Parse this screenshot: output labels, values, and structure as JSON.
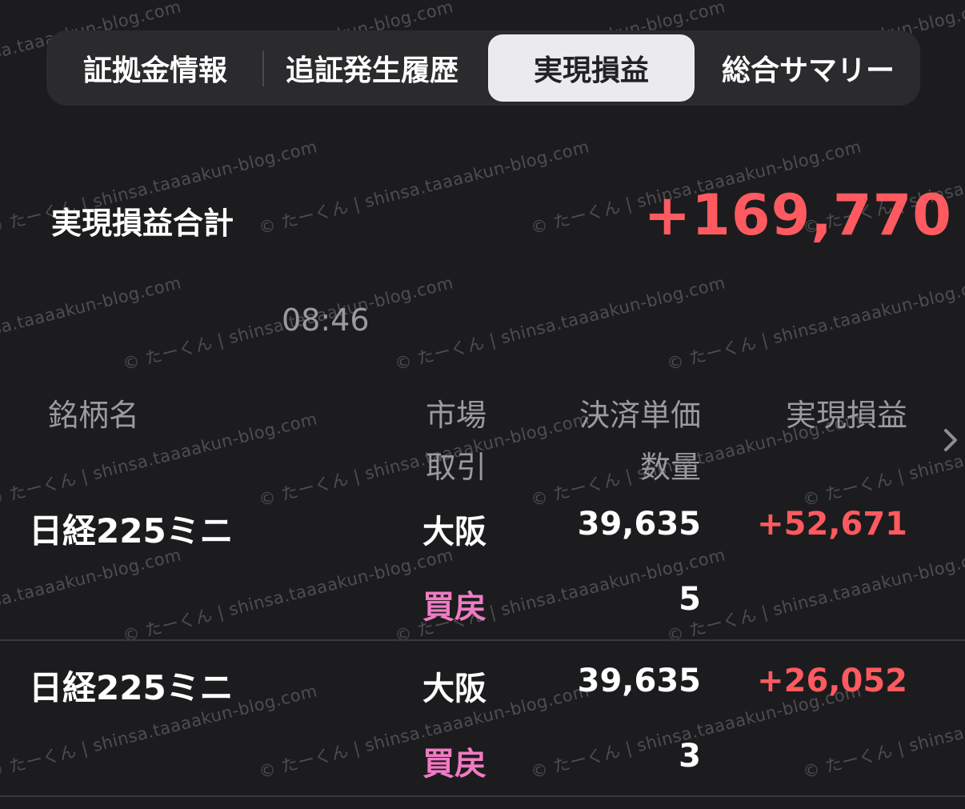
{
  "tabs": [
    {
      "label": "証拠金情報",
      "active": false
    },
    {
      "label": "追証発生履歴",
      "active": false
    },
    {
      "label": "実現損益",
      "active": true
    },
    {
      "label": "総合サマリー",
      "active": false
    }
  ],
  "summary": {
    "label": "実現損益合計",
    "value": "+169,770",
    "time": "08:46"
  },
  "table": {
    "headers": {
      "name": "銘柄名",
      "market": "市場",
      "trade": "取引",
      "price": "決済単価",
      "quantity": "数量",
      "pnl": "実現損益"
    },
    "rows": [
      {
        "name": "日経225ミニ",
        "market": "大阪",
        "price": "39,635",
        "pnl": "+52,671",
        "side": "買戻",
        "quantity": "5"
      },
      {
        "name": "日経225ミニ",
        "market": "大阪",
        "price": "39,635",
        "pnl": "+26,052",
        "side": "買戻",
        "quantity": "3"
      }
    ]
  },
  "watermark": {
    "text": "© たーくん | shinsa.taaaakun-blog.com"
  },
  "colors": {
    "positive": "#ff5a5f",
    "side": "#f07bc3",
    "active_tab_bg": "#ebebef",
    "background": "#1c1c1e"
  },
  "icons": {
    "chevron": "chevron-right-icon"
  }
}
